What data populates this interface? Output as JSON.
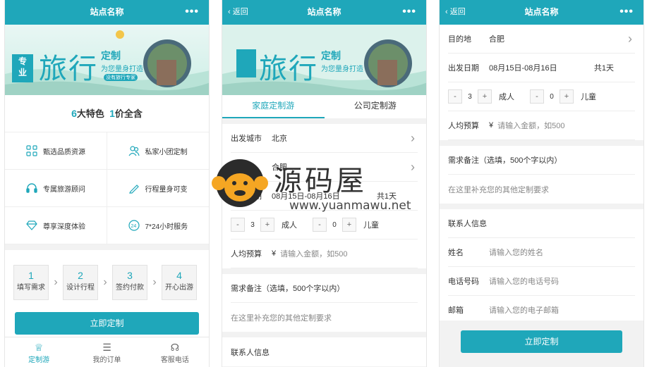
{
  "colors": {
    "accent": "#1fa7ba",
    "divider": "#eeeeee",
    "bg": "#f2f2f2"
  },
  "screen1": {
    "topbar": {
      "title": "站点名称",
      "menu_icon": "more-dots-icon"
    },
    "banner": {
      "tag_line1": "专",
      "tag_line2": "业",
      "headline": "旅行",
      "sub_main": "定制",
      "sub_line": "为您量身打造",
      "badge": "没有旅行专家"
    },
    "features": {
      "title_num1": "6",
      "title_text1": "大特色",
      "title_num2": "1",
      "title_text2": "价全含",
      "items": [
        {
          "label": "甄选品质资源",
          "icon": "grid-icon"
        },
        {
          "label": "私家小团定制",
          "icon": "users-icon"
        },
        {
          "label": "专属旅游顾问",
          "icon": "headset-icon"
        },
        {
          "label": "行程量身可变",
          "icon": "pencil-icon"
        },
        {
          "label": "尊享深度体验",
          "icon": "diamond-icon"
        },
        {
          "label": "7*24小时服务",
          "icon": "clock-24-icon"
        }
      ]
    },
    "steps": [
      {
        "n": "1",
        "label": "填写需求"
      },
      {
        "n": "2",
        "label": "设计行程"
      },
      {
        "n": "3",
        "label": "签约付款"
      },
      {
        "n": "4",
        "label": "开心出游"
      }
    ],
    "cta": "立即定制",
    "tabbar": [
      {
        "label": "定制游",
        "icon": "crown-icon",
        "active": true
      },
      {
        "label": "我的订单",
        "icon": "list-icon",
        "active": false
      },
      {
        "label": "客服电话",
        "icon": "headset-icon",
        "active": false
      }
    ]
  },
  "screen2": {
    "topbar": {
      "back": "返回",
      "title": "站点名称"
    },
    "tabs": [
      "家庭定制游",
      "公司定制游"
    ],
    "depart_label": "出发城市",
    "depart_value": "北京",
    "dest_label": "目的地",
    "dest_value": "合肥",
    "date_label": "出发日期",
    "date_value": "08月15日-08月16日",
    "days": "共1天",
    "adult_count": "3",
    "adult_label": "成人",
    "child_count": "0",
    "child_label": "儿童",
    "budget_label": "人均预算",
    "budget_prefix": "¥",
    "budget_placeholder": "请输入金额，如500",
    "remark_label": "需求备注（选填，500个字以内）",
    "remark_placeholder": "在这里补充您的其他定制要求",
    "contact_title": "联系人信息"
  },
  "screen3": {
    "topbar": {
      "back": "返回",
      "title": "站点名称"
    },
    "dest_label": "目的地",
    "dest_value": "合肥",
    "date_label": "出发日期",
    "date_value": "08月15日-08月16日",
    "days": "共1天",
    "adult_count": "3",
    "adult_label": "成人",
    "child_count": "0",
    "child_label": "儿童",
    "budget_label": "人均预算",
    "budget_prefix": "¥",
    "budget_placeholder": "请输入金额，如500",
    "remark_label": "需求备注（选填，500个字以内）",
    "remark_placeholder": "在这里补充您的其他定制要求",
    "contact_title": "联系人信息",
    "name_label": "姓名",
    "name_placeholder": "请输入您的姓名",
    "phone_label": "电话号码",
    "phone_placeholder": "请输入您的电话号码",
    "email_label": "邮箱",
    "email_placeholder": "请输入您的电子邮箱",
    "submit": "立即定制"
  },
  "watermark": {
    "brand": "源码屋",
    "url": "www.yuanmawu.net"
  }
}
